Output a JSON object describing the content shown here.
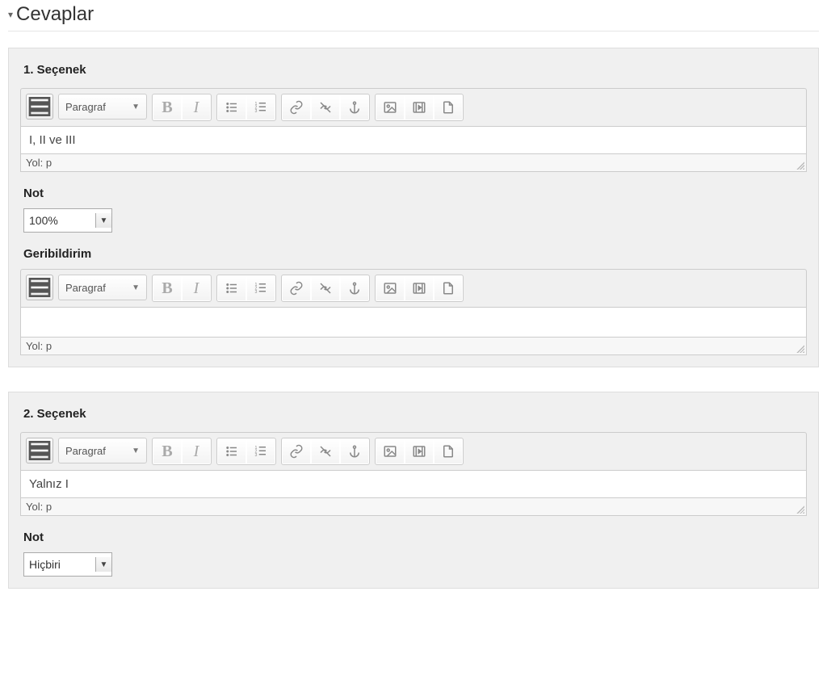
{
  "header": {
    "title": "Cevaplar"
  },
  "toolbar": {
    "format_label": "Paragraf",
    "path_prefix": "Yol: ",
    "path_tag": "p"
  },
  "choices": [
    {
      "title": "1. Seçenek",
      "content": "I, II ve III",
      "grade_label": "Not",
      "grade_value": "100%",
      "feedback_label": "Geribildirim",
      "feedback_content": ""
    },
    {
      "title": "2. Seçenek",
      "content": "Yalnız I",
      "grade_label": "Not",
      "grade_value": "Hiçbiri",
      "feedback_label": null,
      "feedback_content": null
    }
  ]
}
